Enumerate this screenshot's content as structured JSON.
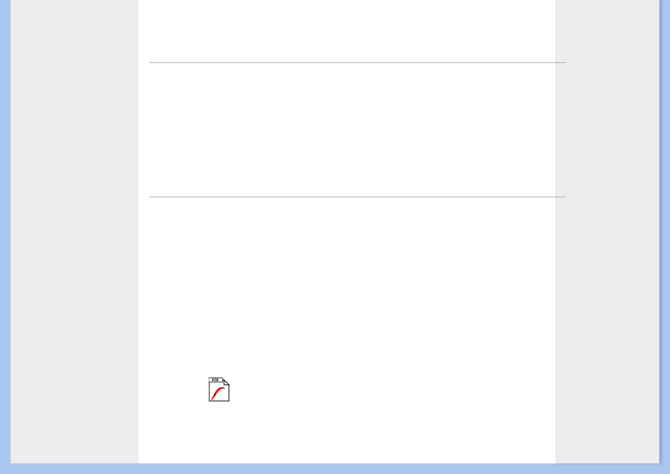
{
  "layout": {
    "left_sidebar": {},
    "main": {
      "dividers": [
        1,
        2
      ],
      "attachment": {
        "icon_name": "pdf-icon",
        "type": "PDF"
      }
    },
    "right_sidebar": {}
  }
}
